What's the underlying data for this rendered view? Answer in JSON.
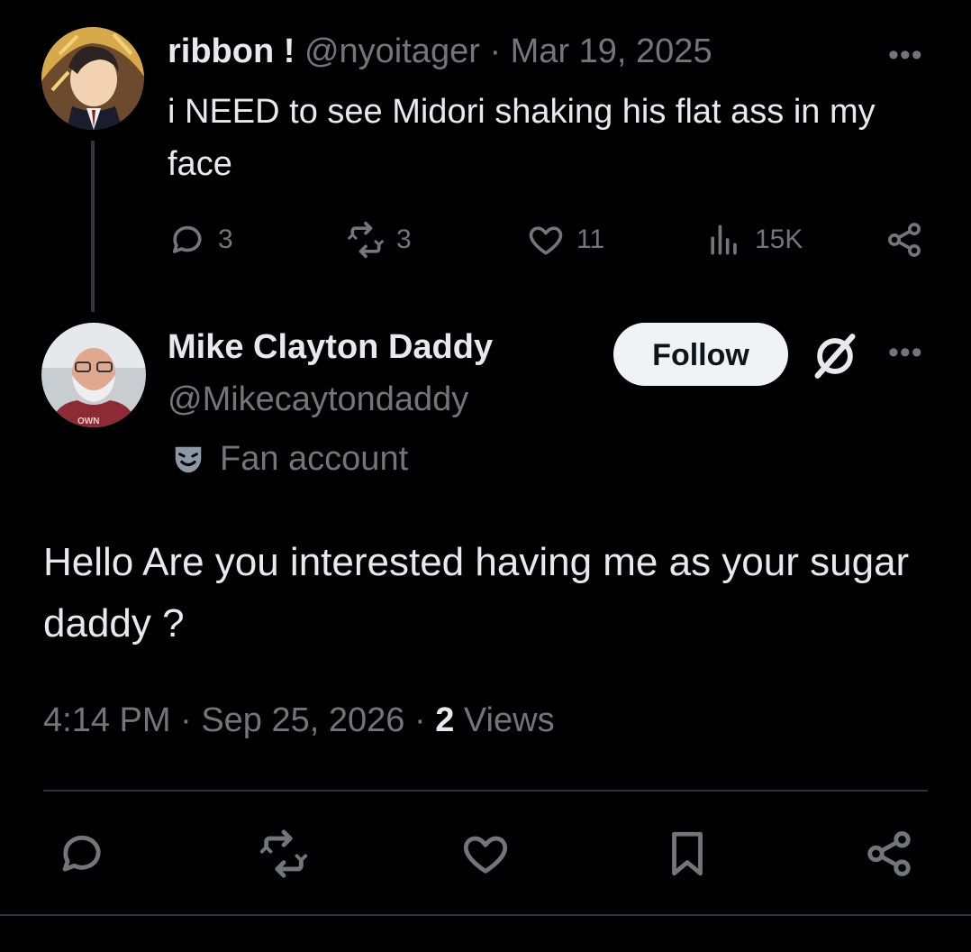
{
  "parent_tweet": {
    "display_name": "ribbon !",
    "handle": "@nyoitager",
    "separator": "·",
    "date": "Mar 19, 2025",
    "text": "i NEED to see Midori shaking his flat ass in my face",
    "more_icon": "more-horizontal-icon",
    "stats": {
      "replies": "3",
      "reposts": "3",
      "likes": "11",
      "views": "15K"
    }
  },
  "reply_tweet": {
    "display_name": "Mike Clayton Daddy",
    "handle": "@Mikecaytondaddy",
    "follow_label": "Follow",
    "badge_label": "Fan account",
    "badge_icon": "theater-mask-icon",
    "text": "Hello Are you interested having me as your sugar daddy ?",
    "time": "4:14 PM",
    "date": "Sep 25, 2026",
    "separator": "·",
    "view_count": "2",
    "views_label": "Views"
  },
  "colors": {
    "background": "#000000",
    "text_primary": "#e7e9ea",
    "text_secondary": "#71767b",
    "follow_bg": "#eff3f4",
    "divider": "#2f3336"
  }
}
